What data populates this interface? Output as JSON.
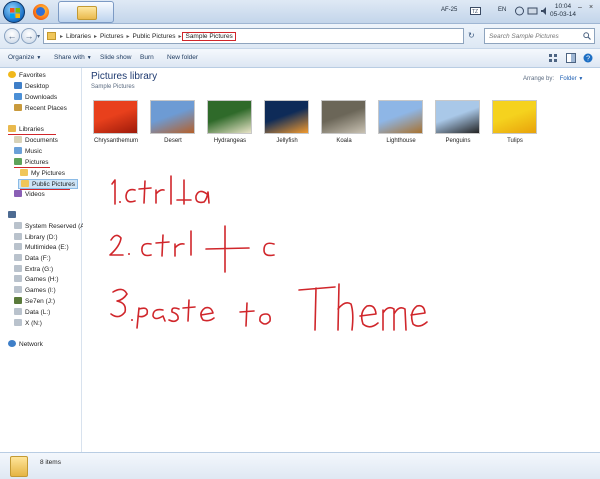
{
  "taskbar": {
    "language": "AF-25",
    "input_lang": "EN",
    "clock_time": "10:04",
    "clock_date": "05-03-14",
    "apps": [
      "firefox-icon",
      "explorer-folder-icon"
    ]
  },
  "address": {
    "crumbs": [
      "Libraries",
      "Pictures",
      "Public Pictures",
      "Sample Pictures"
    ],
    "search_placeholder": "Search Sample Pictures"
  },
  "toolbar": {
    "organize": "Organize",
    "share_with": "Share with",
    "slide_show": "Slide show",
    "burn": "Burn",
    "new_folder": "New folder"
  },
  "sidebar": {
    "favorites": "Favorites",
    "desktop": "Desktop",
    "downloads": "Downloads",
    "recent": "Recent Places",
    "libraries": "Libraries",
    "documents": "Documents",
    "music": "Music",
    "pictures": "Pictures",
    "my_pictures": "My Pictures",
    "public_pictures": "Public Pictures",
    "videos": "Videos",
    "drives": [
      "System Reserved (A:)",
      "Library (D:)",
      "Multimidea (E:)",
      "Data (F:)",
      "Extra (G:)",
      "Games (H:)",
      "Games (I:)",
      "Se7en (J:)",
      "Data (L:)",
      "X (N:)"
    ],
    "network": "Network"
  },
  "content": {
    "title": "Pictures library",
    "subtitle": "Sample Pictures",
    "arrange_label": "Arrange by:",
    "arrange_value": "Folder",
    "thumbnails": [
      {
        "label": "Chrysanthemum",
        "color1": "#e8401c",
        "color2": "#9e1a0a"
      },
      {
        "label": "Desert",
        "color1": "#6d9bd4",
        "color2": "#b5602a"
      },
      {
        "label": "Hydrangeas",
        "color1": "#2f6a2a",
        "color2": "#e9e4c8"
      },
      {
        "label": "Jellyfish",
        "color1": "#0e2b58",
        "color2": "#f29a2e"
      },
      {
        "label": "Koala",
        "color1": "#6b6658",
        "color2": "#c9c2b3"
      },
      {
        "label": "Lighthouse",
        "color1": "#8eb6e6",
        "color2": "#a8722f"
      },
      {
        "label": "Penguins",
        "color1": "#a9c8e8",
        "color2": "#232323"
      },
      {
        "label": "Tulips",
        "color1": "#f5d21e",
        "color2": "#e8a20b"
      }
    ]
  },
  "annotation": {
    "line1": "1. ctrl + a",
    "line2": "2. ctrl + c",
    "line3": "3. paste to Theme"
  },
  "status": {
    "items": "8 items"
  }
}
